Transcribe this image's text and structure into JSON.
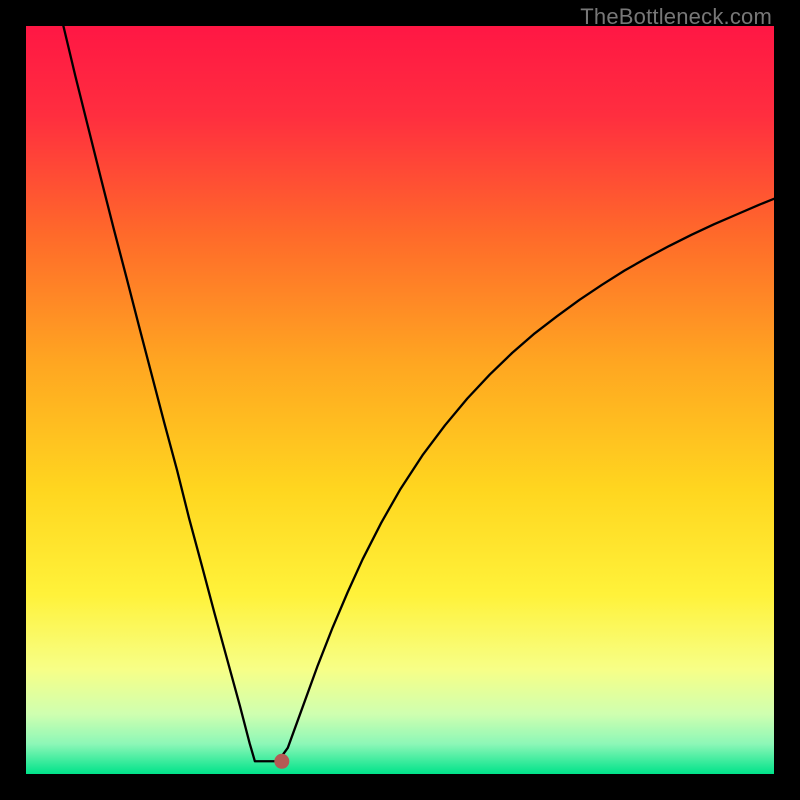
{
  "watermark": "TheBottleneck.com",
  "chart_data": {
    "type": "line",
    "title": "",
    "xlabel": "",
    "ylabel": "",
    "xlim": [
      0,
      100
    ],
    "ylim": [
      0,
      100
    ],
    "background": {
      "type": "vertical-gradient",
      "stops": [
        {
          "offset": 0.0,
          "color": "#ff1744"
        },
        {
          "offset": 0.12,
          "color": "#ff2e3f"
        },
        {
          "offset": 0.28,
          "color": "#ff6a2a"
        },
        {
          "offset": 0.45,
          "color": "#ffa621"
        },
        {
          "offset": 0.62,
          "color": "#ffd61f"
        },
        {
          "offset": 0.76,
          "color": "#fff23a"
        },
        {
          "offset": 0.86,
          "color": "#f7ff87"
        },
        {
          "offset": 0.92,
          "color": "#cfffb0"
        },
        {
          "offset": 0.96,
          "color": "#8cf7b7"
        },
        {
          "offset": 1.0,
          "color": "#00e38a"
        }
      ]
    },
    "series": [
      {
        "name": "bottleneck-curve",
        "stroke": "#000000",
        "stroke_width": 2.3,
        "points": [
          {
            "x": 5.0,
            "y": 100.0
          },
          {
            "x": 6.6,
            "y": 93.3
          },
          {
            "x": 8.3,
            "y": 86.5
          },
          {
            "x": 10.0,
            "y": 79.7
          },
          {
            "x": 11.7,
            "y": 73.0
          },
          {
            "x": 13.4,
            "y": 66.5
          },
          {
            "x": 15.1,
            "y": 59.9
          },
          {
            "x": 16.8,
            "y": 53.4
          },
          {
            "x": 18.5,
            "y": 46.9
          },
          {
            "x": 20.2,
            "y": 40.6
          },
          {
            "x": 21.8,
            "y": 34.2
          },
          {
            "x": 23.5,
            "y": 27.9
          },
          {
            "x": 25.2,
            "y": 21.5
          },
          {
            "x": 26.9,
            "y": 15.3
          },
          {
            "x": 28.6,
            "y": 9.1
          },
          {
            "x": 29.9,
            "y": 4.1
          },
          {
            "x": 30.6,
            "y": 1.7
          },
          {
            "x": 31.4,
            "y": 1.7
          },
          {
            "x": 32.4,
            "y": 1.7
          },
          {
            "x": 33.7,
            "y": 1.7
          },
          {
            "x": 35.0,
            "y": 3.5
          },
          {
            "x": 37.0,
            "y": 9.0
          },
          {
            "x": 39.0,
            "y": 14.5
          },
          {
            "x": 41.0,
            "y": 19.6
          },
          {
            "x": 43.0,
            "y": 24.3
          },
          {
            "x": 45.0,
            "y": 28.7
          },
          {
            "x": 47.5,
            "y": 33.6
          },
          {
            "x": 50.0,
            "y": 38.0
          },
          {
            "x": 53.0,
            "y": 42.6
          },
          {
            "x": 56.0,
            "y": 46.6
          },
          {
            "x": 59.0,
            "y": 50.2
          },
          {
            "x": 62.0,
            "y": 53.4
          },
          {
            "x": 65.0,
            "y": 56.3
          },
          {
            "x": 68.0,
            "y": 58.9
          },
          {
            "x": 71.0,
            "y": 61.2
          },
          {
            "x": 74.0,
            "y": 63.4
          },
          {
            "x": 77.0,
            "y": 65.4
          },
          {
            "x": 80.0,
            "y": 67.3
          },
          {
            "x": 83.0,
            "y": 69.0
          },
          {
            "x": 86.0,
            "y": 70.6
          },
          {
            "x": 89.0,
            "y": 72.1
          },
          {
            "x": 92.0,
            "y": 73.5
          },
          {
            "x": 95.0,
            "y": 74.8
          },
          {
            "x": 98.0,
            "y": 76.1
          },
          {
            "x": 100.0,
            "y": 76.9
          }
        ]
      }
    ],
    "marker": {
      "name": "optimal-point",
      "x": 34.2,
      "y": 1.7,
      "radius": 1.0,
      "fill": "#b55a54"
    }
  }
}
